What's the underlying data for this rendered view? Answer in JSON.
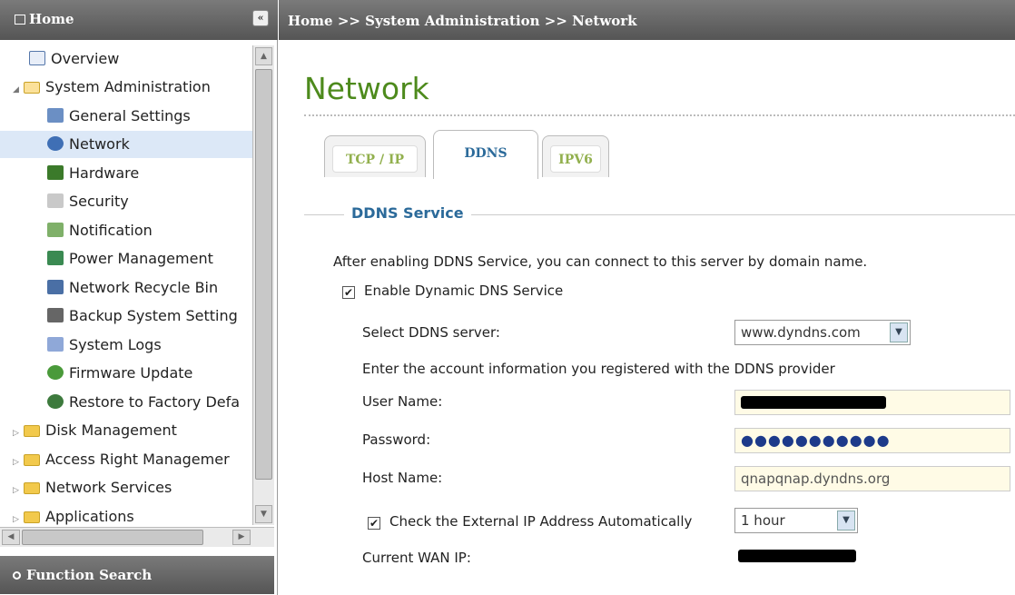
{
  "sidebar": {
    "title": "Home",
    "collapse_label": "«",
    "items": [
      {
        "label": "Overview"
      },
      {
        "label": "System Administration"
      },
      {
        "label": "General Settings"
      },
      {
        "label": "Network"
      },
      {
        "label": "Hardware"
      },
      {
        "label": "Security"
      },
      {
        "label": "Notification"
      },
      {
        "label": "Power Management"
      },
      {
        "label": "Network Recycle Bin"
      },
      {
        "label": "Backup System Setting"
      },
      {
        "label": "System Logs"
      },
      {
        "label": "Firmware Update"
      },
      {
        "label": "Restore to Factory Defa"
      },
      {
        "label": "Disk Management"
      },
      {
        "label": "Access Right Managemer"
      },
      {
        "label": "Network Services"
      },
      {
        "label": "Applications"
      }
    ],
    "function_search": "Function Search"
  },
  "breadcrumb": "Home >> System Administration >> Network",
  "page_title": "Network",
  "tabs": [
    {
      "label": "TCP / IP"
    },
    {
      "label": "DDNS"
    },
    {
      "label": "IPV6"
    }
  ],
  "ddns": {
    "legend": "DDNS Service",
    "intro": "After enabling DDNS Service, you can connect to this server by domain name.",
    "enable_label": "Enable Dynamic DNS Service",
    "enable_checked": "✔",
    "server_label": "Select DDNS server:",
    "server_value": "www.dyndns.com",
    "account_info": "Enter the account information you registered with the DDNS provider",
    "user_label": "User Name:",
    "password_label": "Password:",
    "password_value": "●●●●●●●●●●●",
    "host_label": "Host Name:",
    "host_value": "qnapqnap.dyndns.org",
    "check_ip_label": "Check the External IP Address Automatically",
    "check_ip_checked": "✔",
    "interval_value": "1 hour",
    "wan_label": "Current WAN IP:"
  },
  "colors": {
    "header": "#5f5f5f",
    "title_green": "#4d8a1c",
    "legend_blue": "#2b6a9a",
    "selected_row": "#dce8f7",
    "input_bg": "#fffbe6"
  }
}
